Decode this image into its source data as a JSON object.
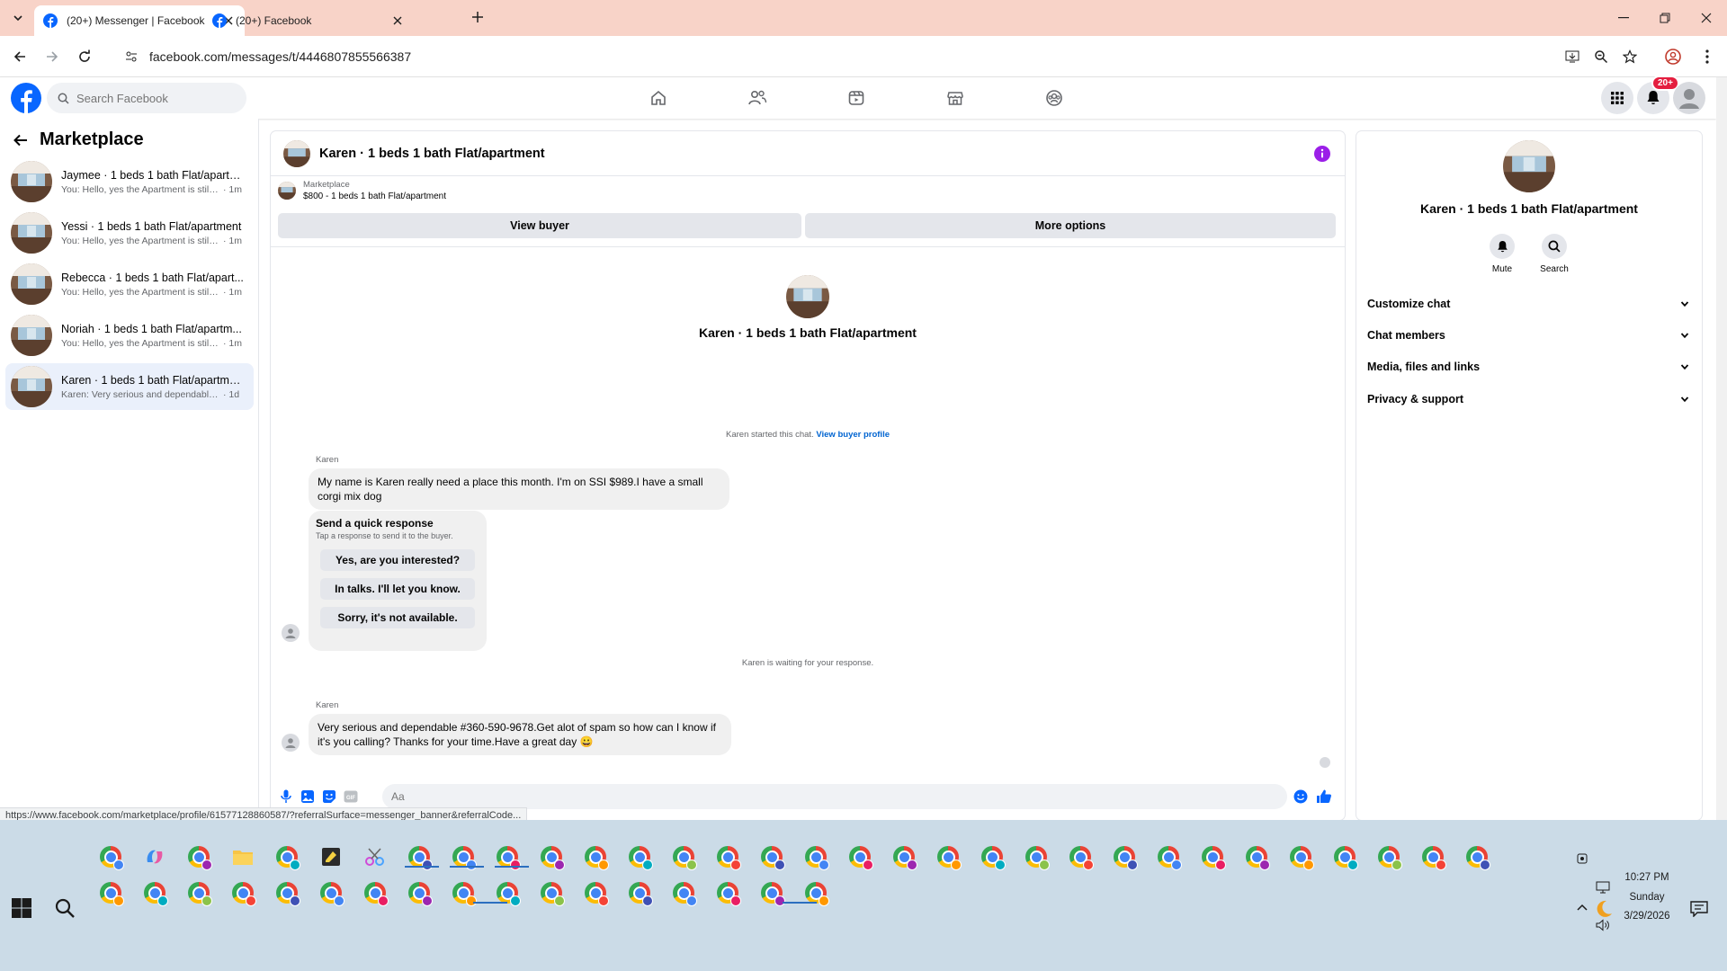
{
  "browser": {
    "tabs": [
      {
        "title": "(20+) Messenger | Facebook",
        "active": true
      },
      {
        "title": "(20+) Facebook",
        "active": false
      }
    ],
    "url": "facebook.com/messages/t/4446807855566387"
  },
  "fb": {
    "search_placeholder": "Search Facebook",
    "notif_badge": "20+"
  },
  "sidebar": {
    "title": "Marketplace",
    "conversations": [
      {
        "name": "Jaymee · 1 beds 1 bath Flat/apartm...",
        "preview": "You: Hello, yes the Apartment is still a...",
        "time": "· 1m"
      },
      {
        "name": "Yessi · 1 beds 1 bath Flat/apartment",
        "preview": "You: Hello, yes the Apartment is still a...",
        "time": "· 1m"
      },
      {
        "name": "Rebecca · 1 beds 1 bath Flat/apart...",
        "preview": "You: Hello, yes the Apartment is still a...",
        "time": "· 1m"
      },
      {
        "name": "Noriah · 1 beds 1 bath Flat/apartm...",
        "preview": "You: Hello, yes the Apartment is still a...",
        "time": "· 1m"
      },
      {
        "name": "Karen · 1 beds 1 bath Flat/apartment",
        "preview": "Karen: Very serious and dependable #...",
        "time": "· 1d"
      }
    ]
  },
  "chat": {
    "header_name": "Karen · 1 beds 1 bath Flat/apartment",
    "listing_label": "Marketplace",
    "listing_title": "$800 - 1 beds 1 bath Flat/apartment",
    "view_buyer": "View buyer",
    "more_options": "More options",
    "center_name": "Karen · 1 beds 1 bath Flat/apartment",
    "started_text": "Karen started this chat.",
    "view_buyer_profile": "View buyer profile",
    "sender1": "Karen",
    "msg1_line1": "My name is Karen really need a place this month. I'm  on SSI $989.I have a small",
    "msg1_line2": "corgi mix dog",
    "quick_title": "Send a quick response",
    "quick_sub": "Tap a response to send it to the buyer.",
    "quick_options": [
      "Yes, are you interested?",
      "In talks. I'll let you know.",
      "Sorry, it's not available."
    ],
    "waiting_text": "Karen is waiting for your response.",
    "sender2": "Karen",
    "msg2_line1": "Very serious  and dependable #360-590-9678.Get alot of spam so how can I know if",
    "msg2_line2": "it's you calling? Thanks for your time.Have a great day 😀",
    "input_placeholder": "Aa"
  },
  "info": {
    "name": "Karen · 1 beds 1 bath Flat/apartment",
    "mute": "Mute",
    "search": "Search",
    "sections": [
      "Customize chat",
      "Chat members",
      "Media, files and links",
      "Privacy & support"
    ]
  },
  "status_url": "https://www.facebook.com/marketplace/profile/61577128860587/?referralSurface=messenger_banner&referralCode...",
  "taskbar": {
    "time": "10:27 PM",
    "day": "Sunday",
    "date": "3/29/2026"
  },
  "colors": {
    "fb_blue": "#0866ff",
    "tab_bar": "#f8d3c8",
    "taskbar": "#cbdbe7",
    "info_purple": "#9b1fe8"
  }
}
